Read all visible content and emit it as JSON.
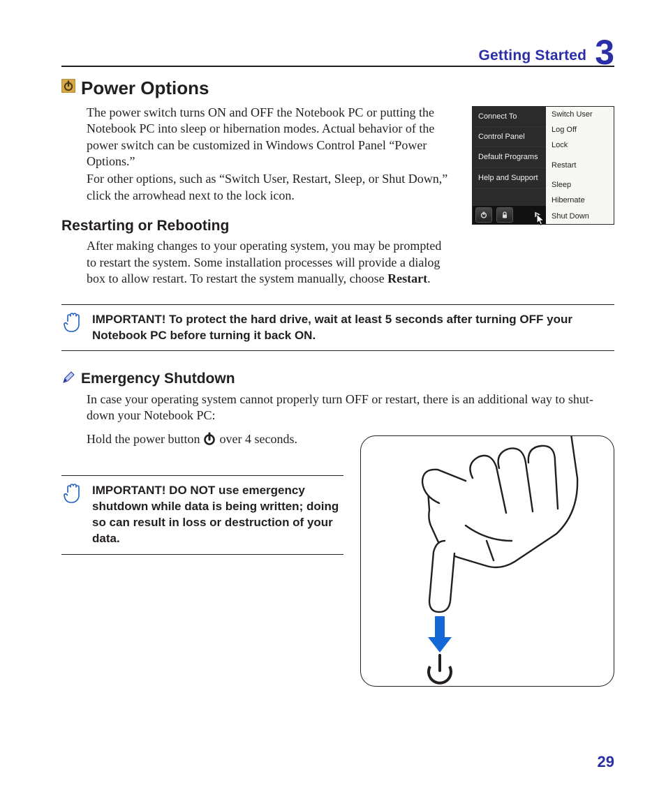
{
  "header": {
    "label": "Getting Started",
    "number": "3"
  },
  "power_options": {
    "title": "Power Options",
    "para1": "The power switch turns ON and OFF the Notebook PC or putting the Notebook PC into sleep or hibernation modes. Actual behavior of the power switch can be customized in Windows Control Panel “Power Options.”",
    "para2": "For other options, such as “Switch User, Restart, Sleep, or Shut Down,” click the arrowhead next to the lock icon."
  },
  "winmenu": {
    "left": [
      "Connect To",
      "Control Panel",
      "Default Programs",
      "Help and Support"
    ],
    "right_top": [
      "Switch User",
      "Log Off",
      "Lock"
    ],
    "right_bottom": [
      "Restart",
      "Sleep",
      "Hibernate",
      "Shut Down"
    ]
  },
  "restart": {
    "title": "Restarting or Rebooting",
    "para_a": "After making changes to your operating system, you may be prompted to restart the system. Some installation processes will provide a dialog box to allow restart. To restart the system manually, choose ",
    "para_b": "Restart",
    "para_c": "."
  },
  "notice1": "IMPORTANT!  To protect the hard drive, wait at least 5 seconds after turning OFF your Notebook PC before turning it back ON.",
  "emergency": {
    "title": "Emergency Shutdown",
    "para": "In case your operating system cannot properly turn OFF or restart, there is an additional way to shut­down your Notebook PC:",
    "hold_a": "Hold the power button",
    "hold_b": "over 4 seconds."
  },
  "notice2": "IMPORTANT!  DO NOT use emergency shutdown while data is being written; doing so can result in loss or destruc­tion of your data.",
  "page_number": "29"
}
